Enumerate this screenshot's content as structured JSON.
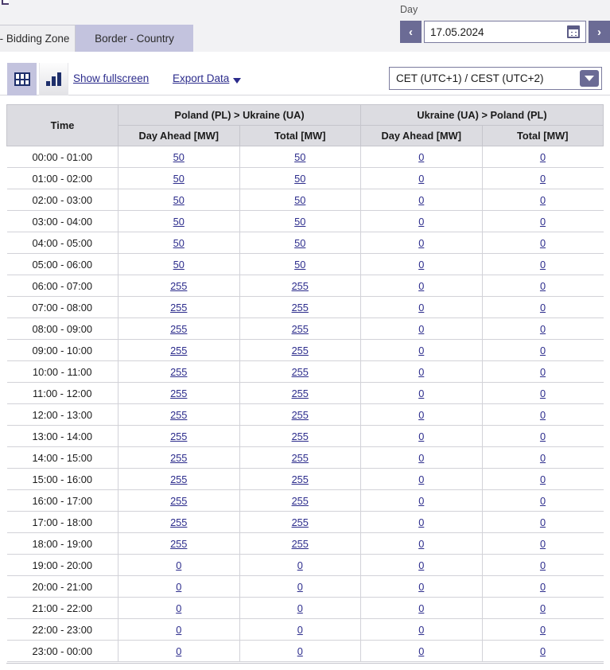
{
  "tabs": [
    {
      "label": "- Bidding Zone",
      "active": false
    },
    {
      "label": "Border - Country",
      "active": true
    }
  ],
  "day_picker": {
    "label": "Day",
    "value": "17.05.2024",
    "prev_label": "‹",
    "next_label": "›",
    "calendar_icon": "calendar-icon"
  },
  "toolbar": {
    "table_view_icon": "table-grid-icon",
    "chart_view_icon": "bar-chart-icon",
    "fullscreen_label": "Show fullscreen",
    "export_label": "Export Data",
    "export_caret_icon": "caret-down-icon"
  },
  "timezone": {
    "selected": "CET (UTC+1) / CEST (UTC+2)",
    "arrow_icon": "dropdown-arrow-icon"
  },
  "colors": {
    "accent_purple": "#6b6b95",
    "tab_active": "#c3c3de",
    "link_blue": "#2c2c8c",
    "header_gray": "#dcdce1"
  },
  "table": {
    "time_header": "Time",
    "groups": [
      {
        "label": "Poland (PL) > Ukraine (UA)",
        "columns": [
          "Day Ahead [MW]",
          "Total [MW]"
        ]
      },
      {
        "label": "Ukraine (UA) > Poland (PL)",
        "columns": [
          "Day Ahead [MW]",
          "Total [MW]"
        ]
      }
    ],
    "rows": [
      {
        "time": "00:00 - 01:00",
        "values": [
          "50",
          "50",
          "0",
          "0"
        ]
      },
      {
        "time": "01:00 - 02:00",
        "values": [
          "50",
          "50",
          "0",
          "0"
        ]
      },
      {
        "time": "02:00 - 03:00",
        "values": [
          "50",
          "50",
          "0",
          "0"
        ]
      },
      {
        "time": "03:00 - 04:00",
        "values": [
          "50",
          "50",
          "0",
          "0"
        ]
      },
      {
        "time": "04:00 - 05:00",
        "values": [
          "50",
          "50",
          "0",
          "0"
        ]
      },
      {
        "time": "05:00 - 06:00",
        "values": [
          "50",
          "50",
          "0",
          "0"
        ]
      },
      {
        "time": "06:00 - 07:00",
        "values": [
          "255",
          "255",
          "0",
          "0"
        ]
      },
      {
        "time": "07:00 - 08:00",
        "values": [
          "255",
          "255",
          "0",
          "0"
        ]
      },
      {
        "time": "08:00 - 09:00",
        "values": [
          "255",
          "255",
          "0",
          "0"
        ]
      },
      {
        "time": "09:00 - 10:00",
        "values": [
          "255",
          "255",
          "0",
          "0"
        ]
      },
      {
        "time": "10:00 - 11:00",
        "values": [
          "255",
          "255",
          "0",
          "0"
        ]
      },
      {
        "time": "11:00 - 12:00",
        "values": [
          "255",
          "255",
          "0",
          "0"
        ]
      },
      {
        "time": "12:00 - 13:00",
        "values": [
          "255",
          "255",
          "0",
          "0"
        ]
      },
      {
        "time": "13:00 - 14:00",
        "values": [
          "255",
          "255",
          "0",
          "0"
        ]
      },
      {
        "time": "14:00 - 15:00",
        "values": [
          "255",
          "255",
          "0",
          "0"
        ]
      },
      {
        "time": "15:00 - 16:00",
        "values": [
          "255",
          "255",
          "0",
          "0"
        ]
      },
      {
        "time": "16:00 - 17:00",
        "values": [
          "255",
          "255",
          "0",
          "0"
        ]
      },
      {
        "time": "17:00 - 18:00",
        "values": [
          "255",
          "255",
          "0",
          "0"
        ]
      },
      {
        "time": "18:00 - 19:00",
        "values": [
          "255",
          "255",
          "0",
          "0"
        ]
      },
      {
        "time": "19:00 - 20:00",
        "values": [
          "0",
          "0",
          "0",
          "0"
        ]
      },
      {
        "time": "20:00 - 21:00",
        "values": [
          "0",
          "0",
          "0",
          "0"
        ]
      },
      {
        "time": "21:00 - 22:00",
        "values": [
          "0",
          "0",
          "0",
          "0"
        ]
      },
      {
        "time": "22:00 - 23:00",
        "values": [
          "0",
          "0",
          "0",
          "0"
        ]
      },
      {
        "time": "23:00 - 00:00",
        "values": [
          "0",
          "0",
          "0",
          "0"
        ]
      }
    ]
  }
}
